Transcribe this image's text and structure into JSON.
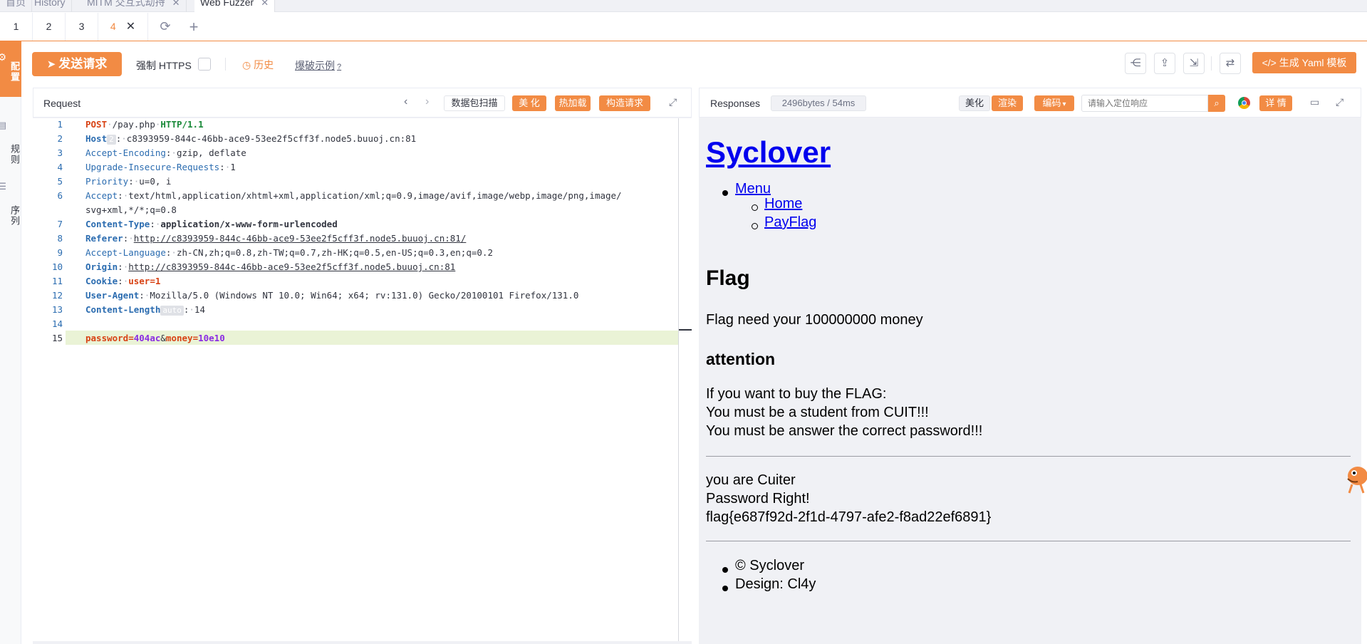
{
  "top_tabs": [
    {
      "label": "首页"
    },
    {
      "label": "History"
    },
    {
      "label": "MITM 交互式劫持"
    },
    {
      "label": "Web Fuzzer"
    }
  ],
  "sub_tabs": [
    "1",
    "2",
    "3",
    "4"
  ],
  "sidebar": {
    "active_label": "配置",
    "rules_label": "规则",
    "sequence_label": "序列"
  },
  "toolbar": {
    "send_label": "发送请求",
    "force_https_label": "强制 HTTPS",
    "history_label": "历史",
    "burst_label": "爆破示例",
    "yaml_label": "生成 Yaml 模板"
  },
  "request_panel": {
    "title": "Request",
    "scan_label": "数据包扫描",
    "beautify_label": "美 化",
    "hotload_label": "热加载",
    "construct_label": "构造请求"
  },
  "response_panel": {
    "title": "Responses",
    "size_badge": "2496bytes / 54ms",
    "beautify_label": "美化",
    "render_label": "渲染",
    "encode_label": "编码",
    "search_placeholder": "请输入定位响应",
    "detail_label": "详 情"
  },
  "request_lines": [
    {
      "n": "1",
      "method": "POST",
      "path": "/pay.php",
      "proto": "HTTP/1.1"
    },
    {
      "n": "2",
      "key": "Host",
      "chip": "2",
      "value": "c8393959-844c-46bb-ace9-53ee2f5cff3f.node5.buuoj.cn:81"
    },
    {
      "n": "3",
      "key": "Accept-Encoding",
      "value": "gzip, deflate"
    },
    {
      "n": "4",
      "key": "Upgrade-Insecure-Requests",
      "value": "1"
    },
    {
      "n": "5",
      "key": "Priority",
      "value": "u=0, i"
    },
    {
      "n": "6",
      "key": "Accept",
      "value": "text/html,application/xhtml+xml,application/xml;q=0.9,image/avif,image/webp,image/png,image/",
      "cont": "svg+xml,*/*;q=0.8"
    },
    {
      "n": "7",
      "key": "Content-Type",
      "value": "application/x-www-form-urlencoded"
    },
    {
      "n": "8",
      "key": "Referer",
      "value": "http://c8393959-844c-46bb-ace9-53ee2f5cff3f.node5.buuoj.cn:81/"
    },
    {
      "n": "9",
      "key": "Accept-Language",
      "value": "zh-CN,zh;q=0.8,zh-TW;q=0.7,zh-HK;q=0.5,en-US;q=0.3,en;q=0.2"
    },
    {
      "n": "10",
      "key": "Origin",
      "value": "http://c8393959-844c-46bb-ace9-53ee2f5cff3f.node5.buuoj.cn:81"
    },
    {
      "n": "11",
      "key": "Cookie",
      "value": "user=1"
    },
    {
      "n": "12",
      "key": "User-Agent",
      "value": "Mozilla/5.0 (Windows NT 10.0; Win64; x64; rv:131.0) Gecko/20100101 Firefox/131.0"
    },
    {
      "n": "13",
      "key": "Content-Length",
      "chip": "auto",
      "value": "14"
    },
    {
      "n": "14"
    },
    {
      "n": "15",
      "body_key1": "password",
      "body_val1": "404ac",
      "body_key2": "money",
      "body_val2": "10e10"
    }
  ],
  "response_page": {
    "heading": "Syclover",
    "menu": "Menu",
    "home": "Home",
    "payflag": "PayFlag",
    "flag_title": "Flag",
    "flag_need": "Flag need your 100000000 money",
    "attention": "attention",
    "line1": "If you want to buy the FLAG:",
    "line2": "You must be a student from CUIT!!!",
    "line3": "You must be answer the correct password!!!",
    "result1": "you are Cuiter",
    "result2": "Password Right!",
    "flag": "flag{e687f92d-2f1d-4797-afe2-f8ad22ef6891}",
    "footer1": "© Syclover",
    "footer2": "Design: Cl4y"
  },
  "colors": {
    "accent": "#f28b44",
    "link": "#0000ee",
    "panel_bg": "#f0f1f5"
  }
}
